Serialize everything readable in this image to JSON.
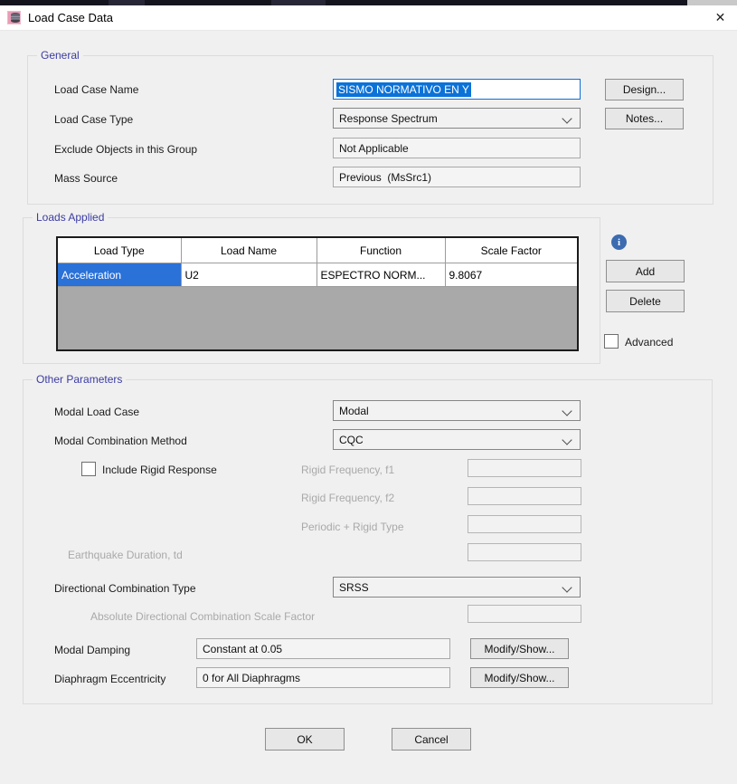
{
  "window": {
    "title": "Load Case Data",
    "close_glyph": "✕"
  },
  "colors": {
    "accent_blue": "#0f6fd6",
    "selection_blue": "#0b72d8",
    "table_selection_blue": "#2a71d8",
    "group_label_purple": "#3b3ba3"
  },
  "general": {
    "title": "General",
    "load_case_name_label": "Load Case Name",
    "load_case_name_value": "SISMO NORMATIVO EN Y",
    "load_case_type_label": "Load Case Type",
    "load_case_type_value": "Response Spectrum",
    "exclude_objects_label": "Exclude Objects in this Group",
    "exclude_objects_value": "Not Applicable",
    "mass_source_label": "Mass Source",
    "mass_source_value": "Previous  (MsSrc1)",
    "design_button": "Design...",
    "notes_button": "Notes..."
  },
  "loads_applied": {
    "title": "Loads Applied",
    "headers": [
      "Load Type",
      "Load Name",
      "Function",
      "Scale Factor"
    ],
    "row": {
      "load_type": "Acceleration",
      "load_name": "U2",
      "function": "ESPECTRO NORM...",
      "scale_factor": "9.8067"
    },
    "info_glyph": "i",
    "add_button": "Add",
    "delete_button": "Delete",
    "advanced_label": "Advanced"
  },
  "other_parameters": {
    "title": "Other Parameters",
    "modal_load_case_label": "Modal Load Case",
    "modal_load_case_value": "Modal",
    "modal_combination_label": "Modal Combination Method",
    "modal_combination_value": "CQC",
    "include_rigid_label": "Include Rigid Response",
    "rigid_f1_label": "Rigid Frequency, f1",
    "rigid_f2_label": "Rigid Frequency, f2",
    "periodic_rigid_label": "Periodic + Rigid Type",
    "earthquake_duration_label": "Earthquake Duration, td",
    "directional_combination_label": "Directional Combination Type",
    "directional_combination_value": "SRSS",
    "abs_directional_label": "Absolute Directional Combination Scale Factor",
    "modal_damping_label": "Modal Damping",
    "modal_damping_value": "Constant at 0.05",
    "modal_damping_button": "Modify/Show...",
    "diaphragm_label": "Diaphragm Eccentricity",
    "diaphragm_value": "0 for All Diaphragms",
    "diaphragm_button": "Modify/Show..."
  },
  "footer": {
    "ok": "OK",
    "cancel": "Cancel"
  }
}
